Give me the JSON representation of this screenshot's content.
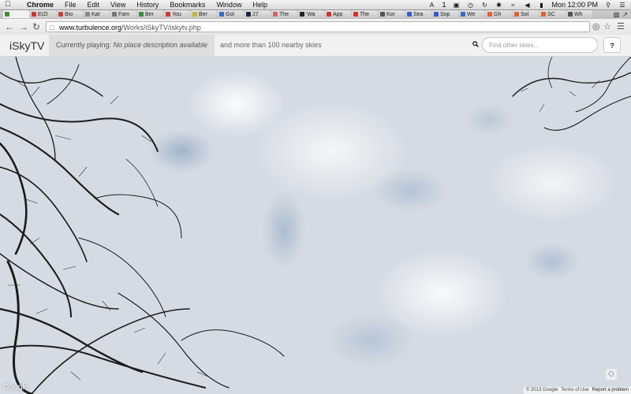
{
  "menubar": {
    "app": "Chrome",
    "menus": [
      "File",
      "Edit",
      "View",
      "History",
      "Bookmarks",
      "Window",
      "Help"
    ],
    "clock": "Mon 12:00 PM",
    "badge": "1"
  },
  "tabs": [
    "",
    "EIZI",
    "Bio",
    "Kat",
    "Fam",
    "Ber",
    "You",
    "Ber",
    "Gol",
    "27",
    "The",
    "'Wa",
    "App",
    "The",
    "Kor",
    "Sea",
    "Sop",
    "We",
    "Gh",
    "Sol",
    "SC",
    "Wh"
  ],
  "tab_colors": [
    "#4a8a3a",
    "#c33",
    "#d04040",
    "#888",
    "#777",
    "#3a8a3a",
    "#cc3a3a",
    "#bb3",
    "#3a6ac8",
    "#224",
    "#c66",
    "#222",
    "#c33",
    "#c33",
    "#555",
    "#3a5ac8",
    "#3a5ac8",
    "#3a6ac8",
    "#e06030",
    "#e06030",
    "#e06030",
    "#555"
  ],
  "browser": {
    "url_host": "www.turbulence.org",
    "url_path": "/Works/iSkyTV/iskytv.php"
  },
  "site": {
    "brand": "iSkyTV",
    "playing_prefix": "Currently playing:",
    "playing_place": "No place description available",
    "nearby": "and more than 100 nearby skies",
    "search_placeholder": "Find other skies...",
    "help_label": "?"
  },
  "map": {
    "google_logo": "Google",
    "copyright": "© 2013 Google",
    "terms": "Terms of Use",
    "report": "Report a problem"
  },
  "colors": {
    "sky_blue": "#7b9ab9",
    "cloud_white": "#f2f3f5",
    "header_bg": "#f1f1f1"
  }
}
